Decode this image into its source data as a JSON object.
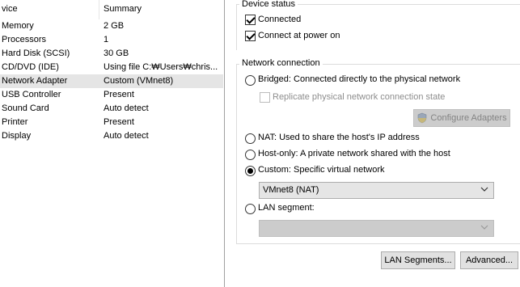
{
  "device_list": {
    "columns": {
      "device": "vice",
      "summary": "Summary"
    },
    "rows": [
      {
        "name": "Memory",
        "summary": "2 GB",
        "selected": false
      },
      {
        "name": "Processors",
        "summary": "1",
        "selected": false
      },
      {
        "name": "Hard Disk (SCSI)",
        "summary": "30 GB",
        "selected": false
      },
      {
        "name": "CD/DVD (IDE)",
        "summary": "Using file C:₩Users₩chris...",
        "selected": false
      },
      {
        "name": "Network Adapter",
        "summary": "Custom (VMnet8)",
        "selected": true
      },
      {
        "name": "USB Controller",
        "summary": "Present",
        "selected": false
      },
      {
        "name": "Sound Card",
        "summary": "Auto detect",
        "selected": false
      },
      {
        "name": "Printer",
        "summary": "Present",
        "selected": false
      },
      {
        "name": "Display",
        "summary": "Auto detect",
        "selected": false
      }
    ]
  },
  "device_status": {
    "title": "Device status",
    "connected": {
      "label": "Connected",
      "checked": true
    },
    "connect_at_power_on": {
      "label": "Connect at power on",
      "checked": true
    }
  },
  "network_connection": {
    "title": "Network connection",
    "bridged": {
      "label": "Bridged: Connected directly to the physical network",
      "selected": false
    },
    "replicate": {
      "label": "Replicate physical network connection state",
      "checked": false,
      "enabled": false
    },
    "configure_adapters": {
      "label": "Configure Adapters",
      "enabled": false,
      "icon": "uac-shield-icon"
    },
    "nat": {
      "label": "NAT: Used to share the host's IP address",
      "selected": false
    },
    "host_only": {
      "label": "Host-only: A private network shared with the host",
      "selected": false
    },
    "custom": {
      "label": "Custom: Specific virtual network",
      "selected": true
    },
    "custom_network_select": {
      "value": "VMnet8 (NAT)"
    },
    "lan_segment": {
      "label": "LAN segment:",
      "selected": false
    },
    "lan_segment_select": {
      "value": "",
      "enabled": false
    }
  },
  "buttons": {
    "lan_segments": "LAN Segments...",
    "advanced": "Advanced..."
  }
}
